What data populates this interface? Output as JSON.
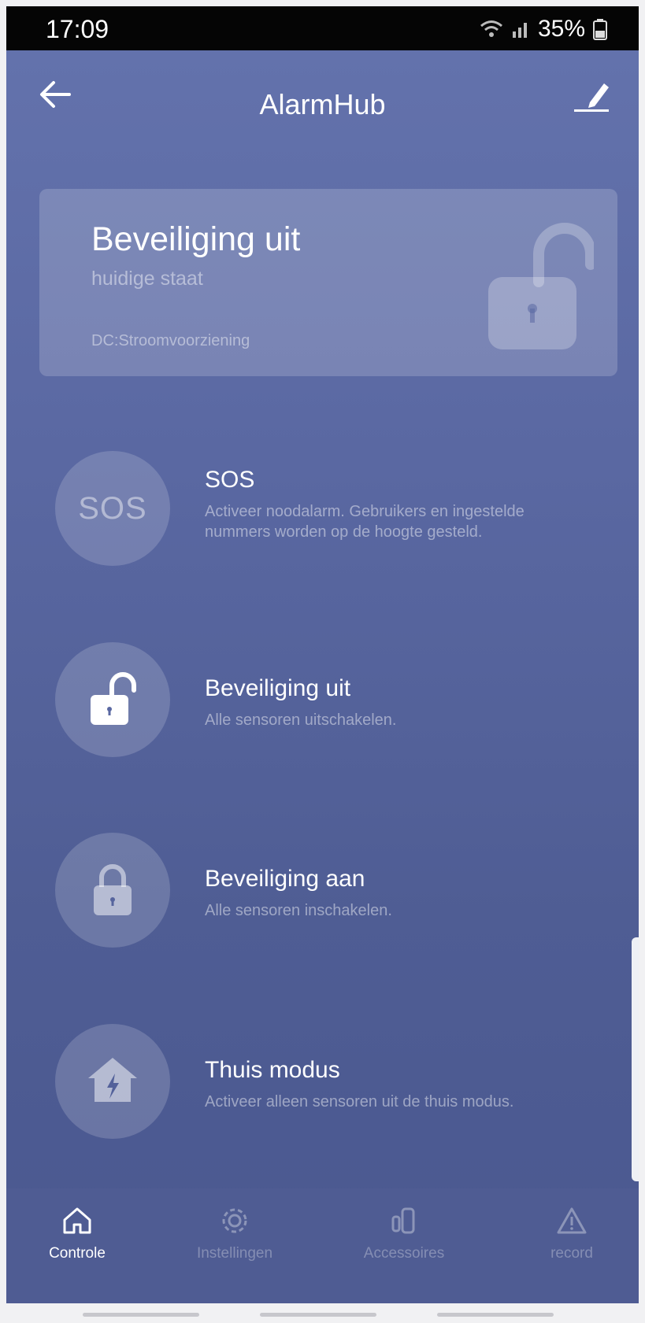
{
  "status_bar": {
    "time": "17:09",
    "battery": "35%"
  },
  "app_bar": {
    "title": "AlarmHub"
  },
  "status_card": {
    "title": "Beveiliging uit",
    "subtitle": "huidige staat",
    "power": "DC:Stroomvoorziening",
    "icon": "unlocked-padlock-icon"
  },
  "actions": [
    {
      "icon": "SOS",
      "title": "SOS",
      "description": "Activeer noodalarm. Gebruikers en ingestelde nummers worden op de hoogte gesteld."
    },
    {
      "icon": "unlock-icon",
      "title": "Beveiliging uit",
      "description": "Alle sensoren uitschakelen."
    },
    {
      "icon": "lock-icon",
      "title": "Beveiliging aan",
      "description": "Alle sensoren inschakelen."
    },
    {
      "icon": "home-icon",
      "title": "Thuis modus",
      "description": "Activeer alleen sensoren uit de thuis modus."
    }
  ],
  "nav": {
    "active": "Controle",
    "items": [
      {
        "label": "Controle",
        "icon": "home-icon"
      },
      {
        "label": "Instellingen",
        "icon": "gear-icon"
      },
      {
        "label": "Accessoires",
        "icon": "sensor-icon"
      },
      {
        "label": "record",
        "icon": "warning-icon"
      }
    ]
  },
  "colors": {
    "background": "#5a68a2",
    "card": "#8590bf",
    "navbar": "#4f5c93",
    "statusbar": "#050505"
  }
}
